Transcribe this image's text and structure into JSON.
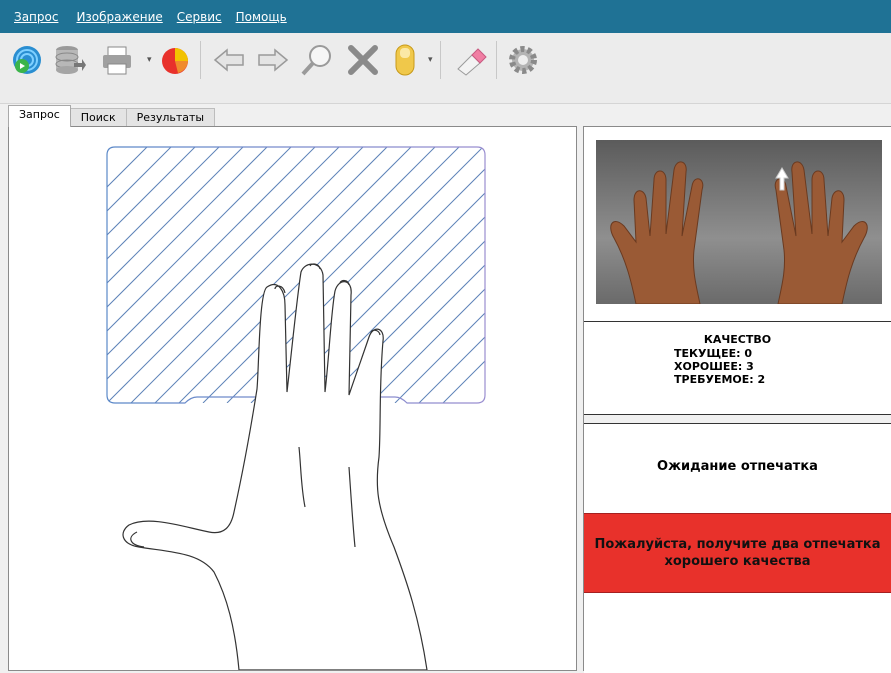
{
  "menu": [
    "Запрос",
    "Изображение",
    "Сервис",
    "Помощь"
  ],
  "toolbar": {
    "icons": [
      "fingerprint-scan-icon",
      "database-icon",
      "print-icon",
      "pie-chart-icon",
      "arrow-left-icon",
      "arrow-right-icon",
      "magnify-icon",
      "delete-icon",
      "finger-icon",
      "eraser-icon",
      "gear-icon"
    ]
  },
  "tabs": [
    "Запрос",
    "Поиск",
    "Результаты"
  ],
  "quality": {
    "title": "КАЧЕСТВО",
    "current": "ТЕКУЩЕЕ: 0",
    "good": "ХОРОШЕЕ: 3",
    "required": "ТРЕБУЕМОЕ: 2"
  },
  "status": {
    "waiting": "Ожидание отпечатка",
    "alert_line1": "Пожалуйста, получите два отпечатка",
    "alert_line2": "хорошего качества"
  },
  "colors": {
    "menubar": "#1f7295",
    "alert": "#e8312b"
  }
}
